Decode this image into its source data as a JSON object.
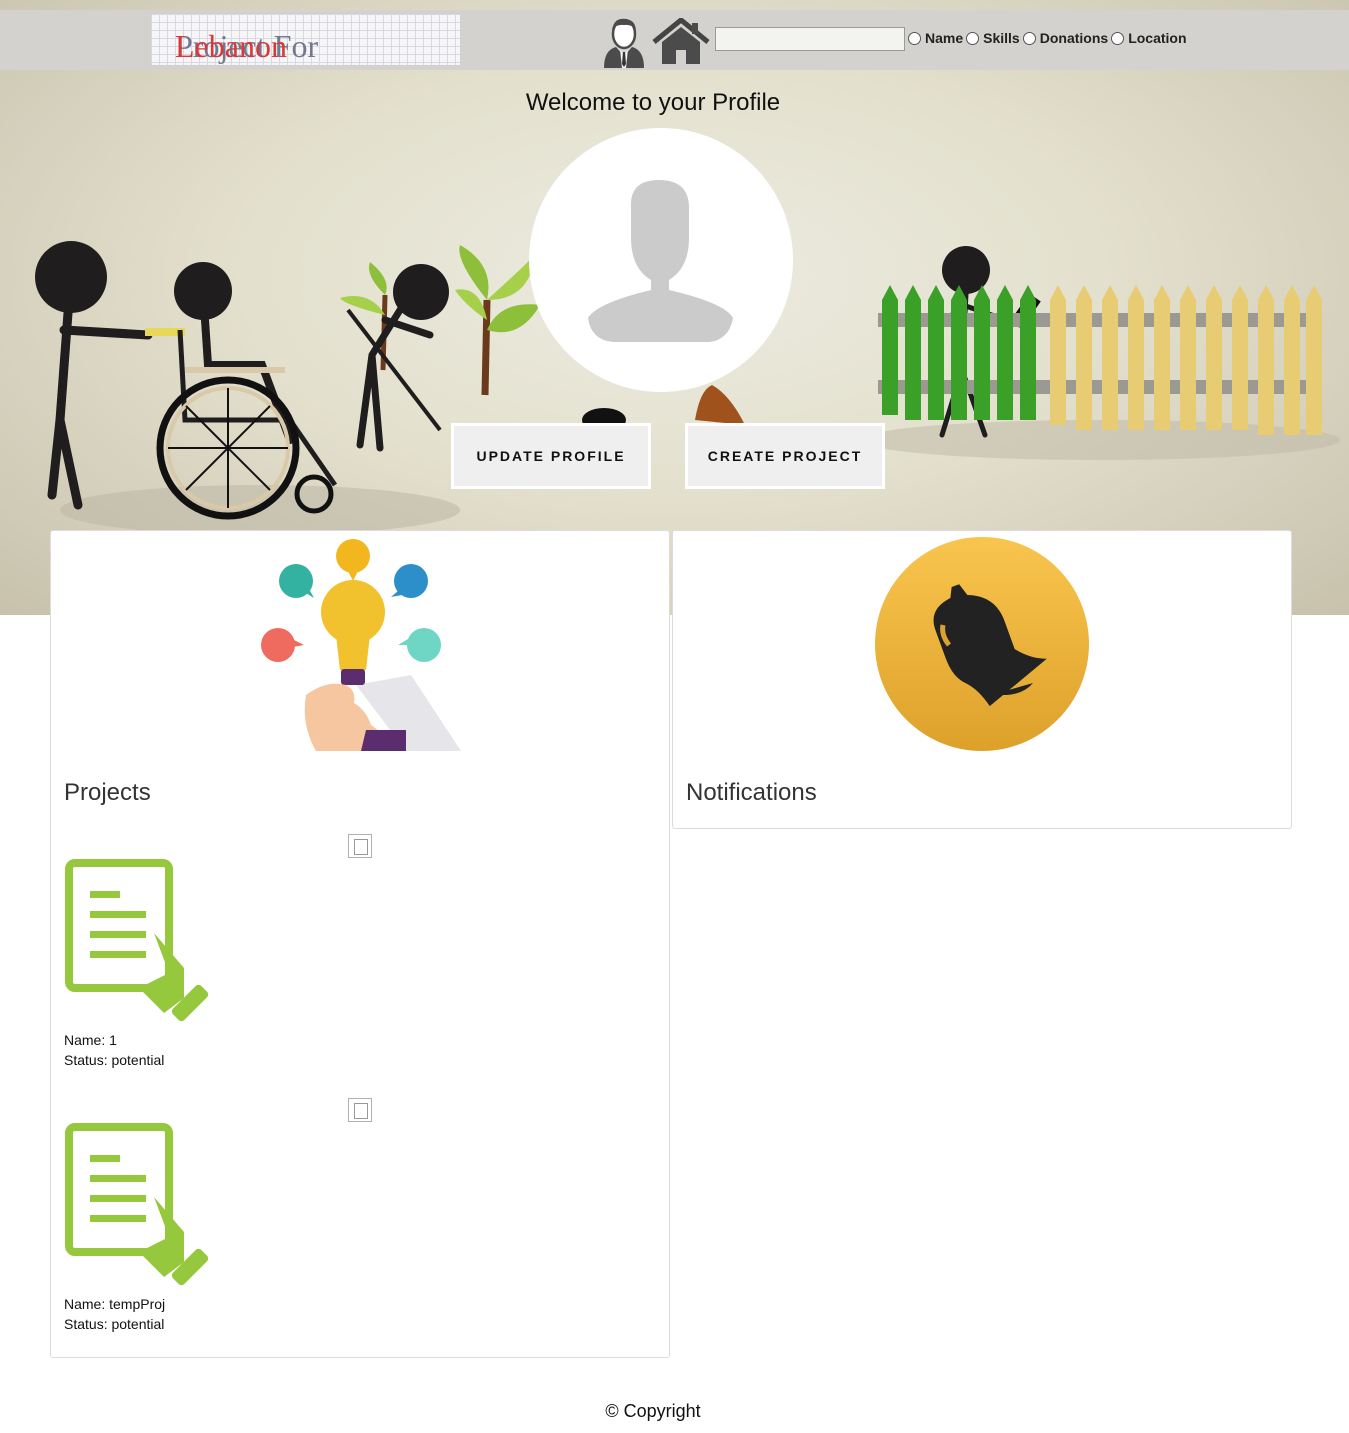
{
  "header": {
    "logo_part1": "Project For ",
    "logo_part2": "Lebanon",
    "search_placeholder": "",
    "search_options": [
      "Name",
      "Skills",
      "Donations",
      "Location"
    ]
  },
  "hero": {
    "welcome": "Welcome to your Profile",
    "update_label": "UPDATE PROFILE",
    "create_label": "CREATE PROJECT"
  },
  "projects": {
    "title": "Projects",
    "items": [
      {
        "name": "Name: 1",
        "status": "Status: potential"
      },
      {
        "name": "Name: tempProj",
        "status": "Status: potential"
      }
    ]
  },
  "notifications": {
    "title": "Notifications"
  },
  "footer": {
    "copyright": "© Copyright"
  },
  "colors": {
    "topbar": "#d3d2ce",
    "logo_accent": "#d6393a",
    "doc_green": "#95c83d",
    "bell_orange": "#f2b335"
  }
}
